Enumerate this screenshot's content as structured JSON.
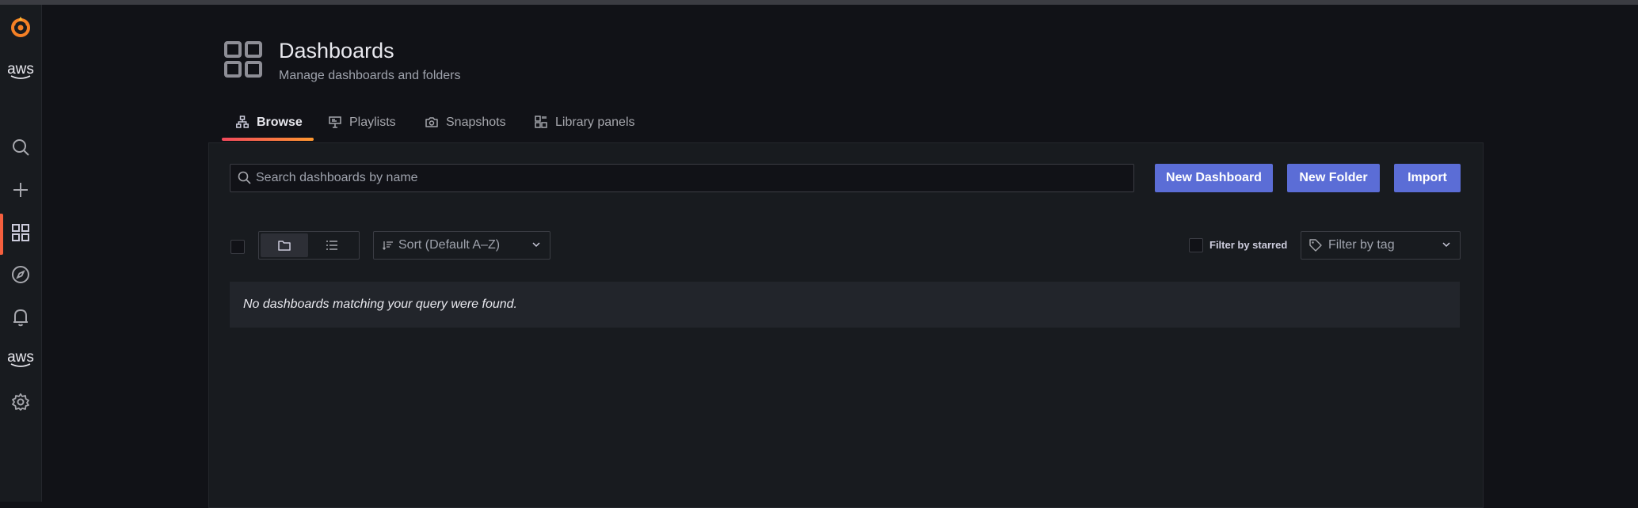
{
  "sidebar": {
    "logo_icon": "grafana-logo-icon",
    "aws_label": "aws",
    "items": [
      {
        "name": "search",
        "icon": "search-icon"
      },
      {
        "name": "create",
        "icon": "plus-icon"
      },
      {
        "name": "dashboards",
        "icon": "grid-icon",
        "active": true
      },
      {
        "name": "explore",
        "icon": "compass-icon"
      },
      {
        "name": "alerting",
        "icon": "bell-icon"
      },
      {
        "name": "aws",
        "icon": "aws-icon",
        "label": "aws"
      },
      {
        "name": "configuration",
        "icon": "gear-icon"
      }
    ]
  },
  "header": {
    "title": "Dashboards",
    "subtitle": "Manage dashboards and folders"
  },
  "tabs": [
    {
      "label": "Browse",
      "icon": "sitemap-icon",
      "active": true
    },
    {
      "label": "Playlists",
      "icon": "presentation-icon"
    },
    {
      "label": "Snapshots",
      "icon": "camera-icon"
    },
    {
      "label": "Library panels",
      "icon": "library-panels-icon"
    }
  ],
  "toolbar": {
    "search_placeholder": "Search dashboards by name",
    "new_dashboard": "New Dashboard",
    "new_folder": "New Folder",
    "import": "Import"
  },
  "filters": {
    "sort_label": "Sort (Default A–Z)",
    "starred_label": "Filter by starred",
    "tag_placeholder": "Filter by tag"
  },
  "results": {
    "empty_message": "No dashboards matching your query were found."
  },
  "colors": {
    "accent": "#f55f3e",
    "primary_button": "#5b6dd6",
    "background": "#111217",
    "panel": "#181b1f"
  }
}
